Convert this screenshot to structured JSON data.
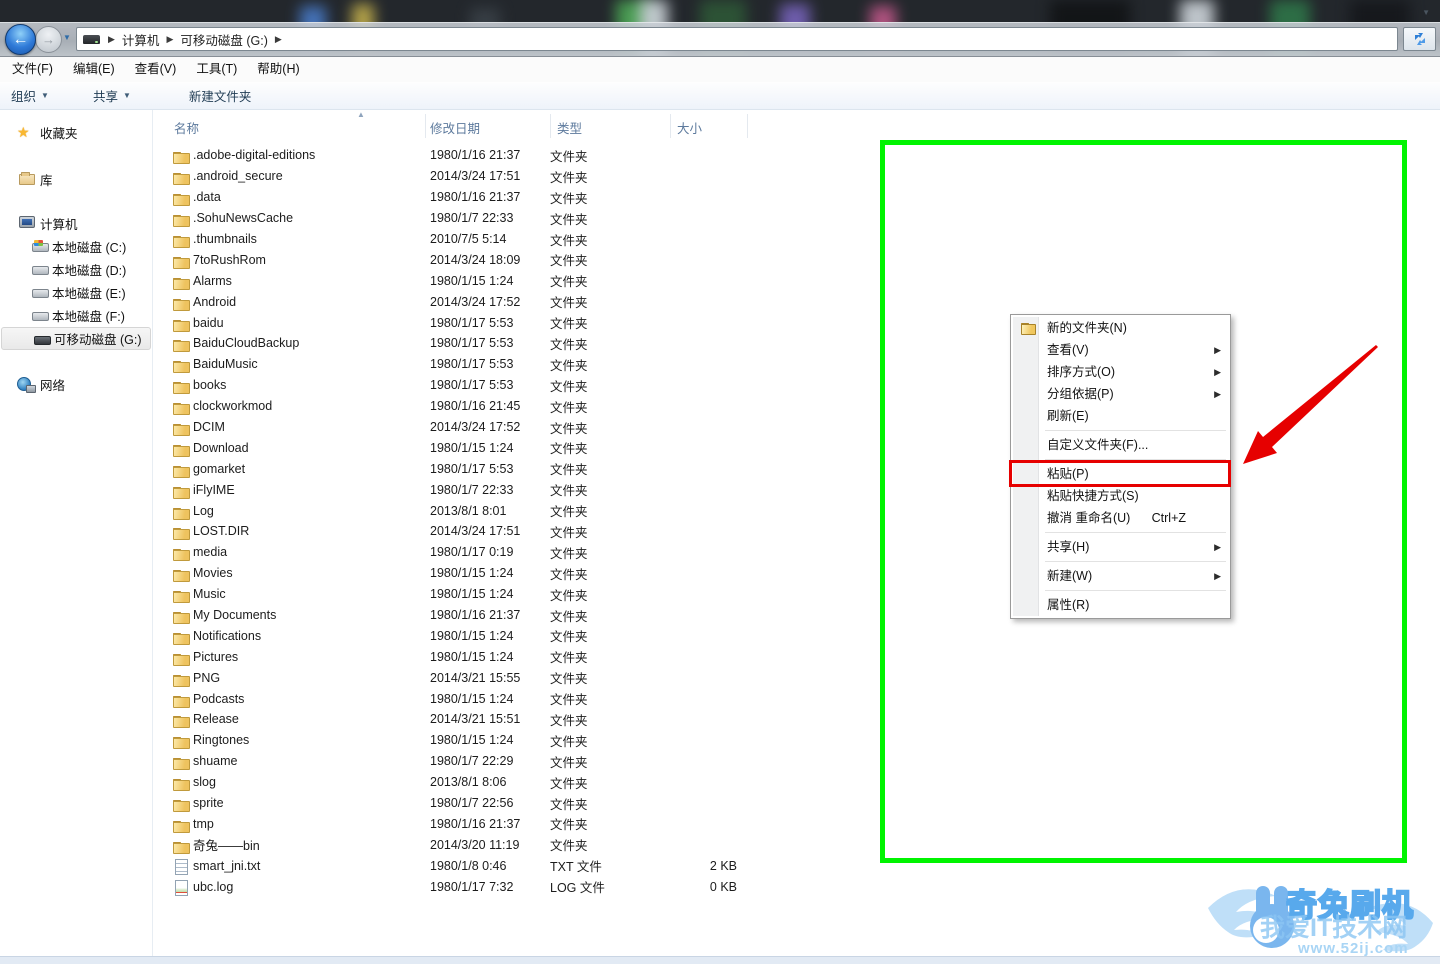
{
  "icons": {
    "dropdown": "▼",
    "caret": "▼",
    "crumb_sep": "▶",
    "submenu": "▶",
    "sort_asc": "▲",
    "back": "←",
    "forward": "→"
  },
  "colors": {
    "annotation_green": "#00f400",
    "annotation_red": "#e60000",
    "selection_accent": "#d5d5d5",
    "watermark_blue": "#58a9ec"
  },
  "window": {
    "breadcrumb": {
      "items": [
        "计算机",
        "可移动磁盘 (G:)"
      ]
    },
    "menu_bar": [
      "文件(F)",
      "编辑(E)",
      "查看(V)",
      "工具(T)",
      "帮助(H)"
    ],
    "command_bar": [
      {
        "label": "组织",
        "dropdown": true
      },
      {
        "label": "共享",
        "dropdown": true
      },
      {
        "label": "新建文件夹",
        "dropdown": false
      }
    ]
  },
  "sidebar": {
    "items": [
      {
        "label": "收藏夹",
        "icon": "star",
        "level": 0,
        "selected": false
      },
      {
        "label": "库",
        "icon": "lib",
        "level": 0,
        "selected": false
      },
      {
        "label": "计算机",
        "icon": "pc",
        "level": 0,
        "selected": false
      },
      {
        "label": "本地磁盘 (C:)",
        "icon": "sysdrive",
        "level": 1,
        "selected": false
      },
      {
        "label": "本地磁盘 (D:)",
        "icon": "drive",
        "level": 1,
        "selected": false
      },
      {
        "label": "本地磁盘 (E:)",
        "icon": "drive",
        "level": 1,
        "selected": false
      },
      {
        "label": "本地磁盘 (F:)",
        "icon": "drive",
        "level": 1,
        "selected": false
      },
      {
        "label": "可移动磁盘 (G:)",
        "icon": "usb",
        "level": 1,
        "selected": true
      },
      {
        "label": "网络",
        "icon": "net",
        "level": 0,
        "selected": false
      }
    ]
  },
  "file_list": {
    "columns": [
      {
        "label": "名称",
        "sorted": "asc"
      },
      {
        "label": "修改日期",
        "sorted": null
      },
      {
        "label": "类型",
        "sorted": null
      },
      {
        "label": "大小",
        "sorted": null
      }
    ],
    "rows": [
      {
        "name": ".adobe-digital-editions",
        "date": "1980/1/16 21:37",
        "type": "文件夹",
        "size": "",
        "icon": "folder"
      },
      {
        "name": ".android_secure",
        "date": "2014/3/24 17:51",
        "type": "文件夹",
        "size": "",
        "icon": "folder"
      },
      {
        "name": ".data",
        "date": "1980/1/16 21:37",
        "type": "文件夹",
        "size": "",
        "icon": "folder"
      },
      {
        "name": ".SohuNewsCache",
        "date": "1980/1/7 22:33",
        "type": "文件夹",
        "size": "",
        "icon": "folder"
      },
      {
        "name": ".thumbnails",
        "date": "2010/7/5 5:14",
        "type": "文件夹",
        "size": "",
        "icon": "folder"
      },
      {
        "name": "7toRushRom",
        "date": "2014/3/24 18:09",
        "type": "文件夹",
        "size": "",
        "icon": "folder"
      },
      {
        "name": "Alarms",
        "date": "1980/1/15 1:24",
        "type": "文件夹",
        "size": "",
        "icon": "folder"
      },
      {
        "name": "Android",
        "date": "2014/3/24 17:52",
        "type": "文件夹",
        "size": "",
        "icon": "folder"
      },
      {
        "name": "baidu",
        "date": "1980/1/17 5:53",
        "type": "文件夹",
        "size": "",
        "icon": "folder"
      },
      {
        "name": "BaiduCloudBackup",
        "date": "1980/1/17 5:53",
        "type": "文件夹",
        "size": "",
        "icon": "folder"
      },
      {
        "name": "BaiduMusic",
        "date": "1980/1/17 5:53",
        "type": "文件夹",
        "size": "",
        "icon": "folder"
      },
      {
        "name": "books",
        "date": "1980/1/17 5:53",
        "type": "文件夹",
        "size": "",
        "icon": "folder"
      },
      {
        "name": "clockworkmod",
        "date": "1980/1/16 21:45",
        "type": "文件夹",
        "size": "",
        "icon": "folder"
      },
      {
        "name": "DCIM",
        "date": "2014/3/24 17:52",
        "type": "文件夹",
        "size": "",
        "icon": "folder"
      },
      {
        "name": "Download",
        "date": "1980/1/15 1:24",
        "type": "文件夹",
        "size": "",
        "icon": "folder"
      },
      {
        "name": "gomarket",
        "date": "1980/1/17 5:53",
        "type": "文件夹",
        "size": "",
        "icon": "folder"
      },
      {
        "name": "iFlyIME",
        "date": "1980/1/7 22:33",
        "type": "文件夹",
        "size": "",
        "icon": "folder"
      },
      {
        "name": "Log",
        "date": "2013/8/1 8:01",
        "type": "文件夹",
        "size": "",
        "icon": "folder"
      },
      {
        "name": "LOST.DIR",
        "date": "2014/3/24 17:51",
        "type": "文件夹",
        "size": "",
        "icon": "folder"
      },
      {
        "name": "media",
        "date": "1980/1/17 0:19",
        "type": "文件夹",
        "size": "",
        "icon": "folder"
      },
      {
        "name": "Movies",
        "date": "1980/1/15 1:24",
        "type": "文件夹",
        "size": "",
        "icon": "folder"
      },
      {
        "name": "Music",
        "date": "1980/1/15 1:24",
        "type": "文件夹",
        "size": "",
        "icon": "folder"
      },
      {
        "name": "My Documents",
        "date": "1980/1/16 21:37",
        "type": "文件夹",
        "size": "",
        "icon": "folder"
      },
      {
        "name": "Notifications",
        "date": "1980/1/15 1:24",
        "type": "文件夹",
        "size": "",
        "icon": "folder"
      },
      {
        "name": "Pictures",
        "date": "1980/1/15 1:24",
        "type": "文件夹",
        "size": "",
        "icon": "folder"
      },
      {
        "name": "PNG",
        "date": "2014/3/21 15:55",
        "type": "文件夹",
        "size": "",
        "icon": "folder"
      },
      {
        "name": "Podcasts",
        "date": "1980/1/15 1:24",
        "type": "文件夹",
        "size": "",
        "icon": "folder"
      },
      {
        "name": "Release",
        "date": "2014/3/21 15:51",
        "type": "文件夹",
        "size": "",
        "icon": "folder"
      },
      {
        "name": "Ringtones",
        "date": "1980/1/15 1:24",
        "type": "文件夹",
        "size": "",
        "icon": "folder"
      },
      {
        "name": "shuame",
        "date": "1980/1/7 22:29",
        "type": "文件夹",
        "size": "",
        "icon": "folder"
      },
      {
        "name": "slog",
        "date": "2013/8/1 8:06",
        "type": "文件夹",
        "size": "",
        "icon": "folder"
      },
      {
        "name": "sprite",
        "date": "1980/1/7 22:56",
        "type": "文件夹",
        "size": "",
        "icon": "folder"
      },
      {
        "name": "tmp",
        "date": "1980/1/16 21:37",
        "type": "文件夹",
        "size": "",
        "icon": "folder"
      },
      {
        "name": "奇兔——bin",
        "date": "2014/3/20 11:19",
        "type": "文件夹",
        "size": "",
        "icon": "folder"
      },
      {
        "name": "smart_jni.txt",
        "date": "1980/1/8 0:46",
        "type": "TXT 文件",
        "size": "2 KB",
        "icon": "txt"
      },
      {
        "name": "ubc.log",
        "date": "1980/1/17 7:32",
        "type": "LOG 文件",
        "size": "0 KB",
        "icon": "log"
      }
    ]
  },
  "context_menu": {
    "items": [
      {
        "label": "新的文件夹(N)",
        "icon": "folder",
        "submenu": false,
        "shortcut": "",
        "sep_after": false,
        "highlighted": false
      },
      {
        "label": "查看(V)",
        "icon": "",
        "submenu": true,
        "shortcut": "",
        "sep_after": false,
        "highlighted": false
      },
      {
        "label": "排序方式(O)",
        "icon": "",
        "submenu": true,
        "shortcut": "",
        "sep_after": false,
        "highlighted": false
      },
      {
        "label": "分组依据(P)",
        "icon": "",
        "submenu": true,
        "shortcut": "",
        "sep_after": false,
        "highlighted": false
      },
      {
        "label": "刷新(E)",
        "icon": "",
        "submenu": false,
        "shortcut": "",
        "sep_after": true,
        "highlighted": false
      },
      {
        "label": "自定义文件夹(F)...",
        "icon": "",
        "submenu": false,
        "shortcut": "",
        "sep_after": true,
        "highlighted": false
      },
      {
        "label": "粘贴(P)",
        "icon": "",
        "submenu": false,
        "shortcut": "",
        "sep_after": false,
        "highlighted": true
      },
      {
        "label": "粘贴快捷方式(S)",
        "icon": "",
        "submenu": false,
        "shortcut": "",
        "sep_after": false,
        "highlighted": false
      },
      {
        "label": "撤消 重命名(U)",
        "icon": "",
        "submenu": false,
        "shortcut": "Ctrl+Z",
        "sep_after": true,
        "highlighted": false
      },
      {
        "label": "共享(H)",
        "icon": "",
        "submenu": true,
        "shortcut": "",
        "sep_after": true,
        "highlighted": false
      },
      {
        "label": "新建(W)",
        "icon": "",
        "submenu": true,
        "shortcut": "",
        "sep_after": true,
        "highlighted": false
      },
      {
        "label": "属性(R)",
        "icon": "",
        "submenu": false,
        "shortcut": "",
        "sep_after": false,
        "highlighted": false
      }
    ]
  },
  "watermark": {
    "brand": "奇兔刷机",
    "overlay": "我爱IT技术网",
    "url": "www.52ij.com"
  }
}
